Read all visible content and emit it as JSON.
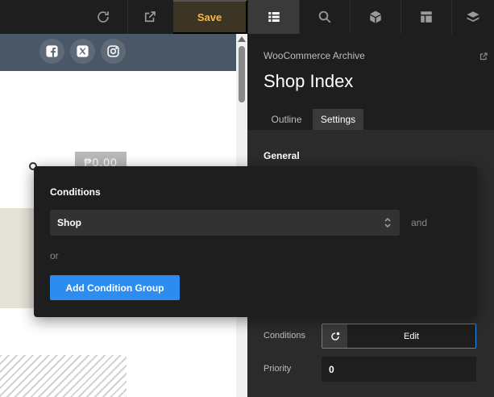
{
  "toolbar": {
    "save_label": "Save",
    "icons": [
      "refresh-icon",
      "external-link-icon",
      "outline-list-icon",
      "search-icon",
      "box-icon",
      "layout-icon",
      "layers-icon"
    ]
  },
  "canvas": {
    "price": "₱0.00",
    "social_icons": [
      "facebook-icon",
      "x-icon",
      "instagram-icon"
    ]
  },
  "panel": {
    "breadcrumb": "WooCommerce Archive",
    "title": "Shop Index",
    "tabs": [
      {
        "label": "Outline",
        "active": false
      },
      {
        "label": "Settings",
        "active": true
      }
    ],
    "section_general": "General",
    "conditions_label": "Conditions",
    "conditions_button": "Edit",
    "priority_label": "Priority",
    "priority_value": "0"
  },
  "popover": {
    "title": "Conditions",
    "selected_condition": "Shop",
    "and_label": "and",
    "or_label": "or",
    "add_group_label": "Add Condition Group"
  },
  "colors": {
    "accent_blue": "#2d8cf0",
    "save_text": "#f5b942",
    "panel_bg": "#2b2b2b",
    "header_bg": "#1e1e1e"
  }
}
